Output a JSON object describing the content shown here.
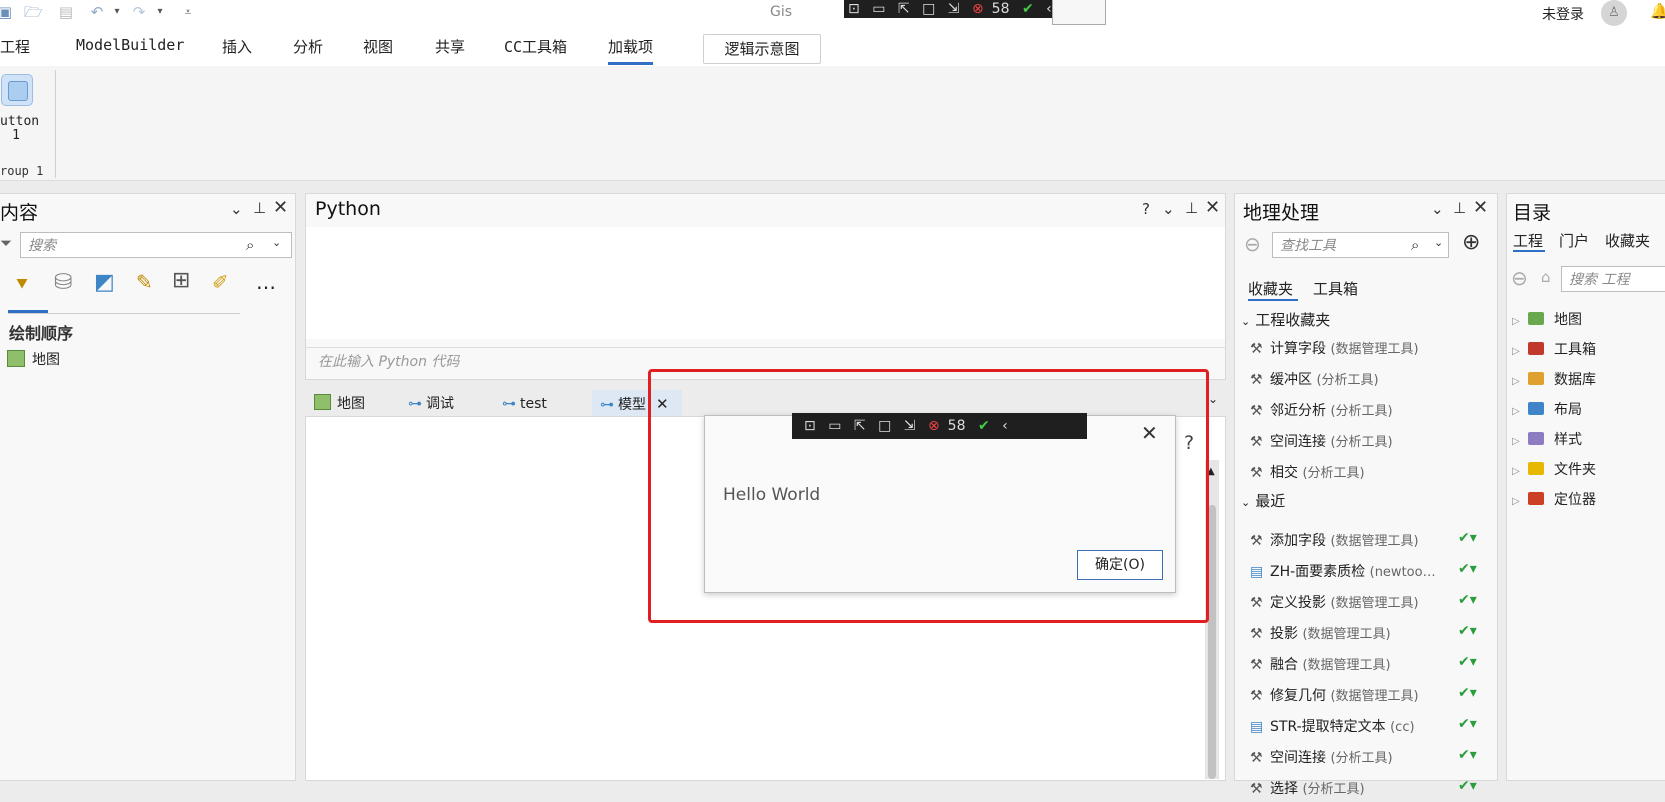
{
  "window": {
    "title_fragment": "Gis"
  },
  "auth": {
    "status": "未登录"
  },
  "ribbon_tabs": [
    "工程",
    "ModelBuilder",
    "插入",
    "分析",
    "视图",
    "共享",
    "CC工具箱",
    "加载项"
  ],
  "active_tab": "加载项",
  "contextual_tab": "逻辑示意图",
  "ribbon_group": {
    "button_label_line1": "utton",
    "button_label_line2": "1",
    "group_label": "roup 1"
  },
  "contents_pane": {
    "title": "内容",
    "search_placeholder": "搜索",
    "section": "绘制顺序",
    "layer": "地图"
  },
  "python_pane": {
    "title": "Python",
    "help": "?",
    "input_placeholder": "在此输入 Python 代码"
  },
  "doc_tabs": [
    {
      "label": "地图"
    },
    {
      "label": "调试"
    },
    {
      "label": "test"
    },
    {
      "label": "模型"
    }
  ],
  "dialog": {
    "message": "Hello World",
    "ok_button": "确定(O)"
  },
  "debug_toolbar": {
    "fps": "58"
  },
  "geo_pane": {
    "title": "地理处理",
    "search_placeholder": "查找工具",
    "tab_favorites": "收藏夹",
    "tab_toolboxes": "工具箱",
    "section_project": "工程收藏夹",
    "project_tools": [
      {
        "name": "计算字段",
        "sub": "(数据管理工具)"
      },
      {
        "name": "缓冲区",
        "sub": "(分析工具)"
      },
      {
        "name": "邻近分析",
        "sub": "(分析工具)"
      },
      {
        "name": "空间连接",
        "sub": "(分析工具)"
      },
      {
        "name": "相交",
        "sub": "(分析工具)"
      }
    ],
    "section_recent": "最近",
    "recent_tools": [
      {
        "name": "添加字段",
        "sub": "(数据管理工具)"
      },
      {
        "name": "ZH-面要素质检",
        "sub": "(newtoo…"
      },
      {
        "name": "定义投影",
        "sub": "(数据管理工具)"
      },
      {
        "name": "投影",
        "sub": "(数据管理工具)"
      },
      {
        "name": "融合",
        "sub": "(数据管理工具)"
      },
      {
        "name": "修复几何",
        "sub": "(数据管理工具)"
      },
      {
        "name": "STR-提取特定文本",
        "sub": "(cc)"
      },
      {
        "name": "空间连接",
        "sub": "(分析工具)"
      },
      {
        "name": "选择",
        "sub": "(分析工具)"
      }
    ]
  },
  "catalog_pane": {
    "title": "目录",
    "tabs": [
      "工程",
      "门户",
      "收藏夹"
    ],
    "search_placeholder": "搜索 工程",
    "items": [
      "地图",
      "工具箱",
      "数据库",
      "布局",
      "样式",
      "文件夹",
      "定位器"
    ],
    "item_colors": [
      "#6aa84f",
      "#c0392b",
      "#e0a030",
      "#3d85c6",
      "#8e7cc3",
      "#e6b800",
      "#cc4125"
    ]
  },
  "colors": {
    "accent": "#2f6fc4",
    "highlight_border": "#e02020"
  }
}
